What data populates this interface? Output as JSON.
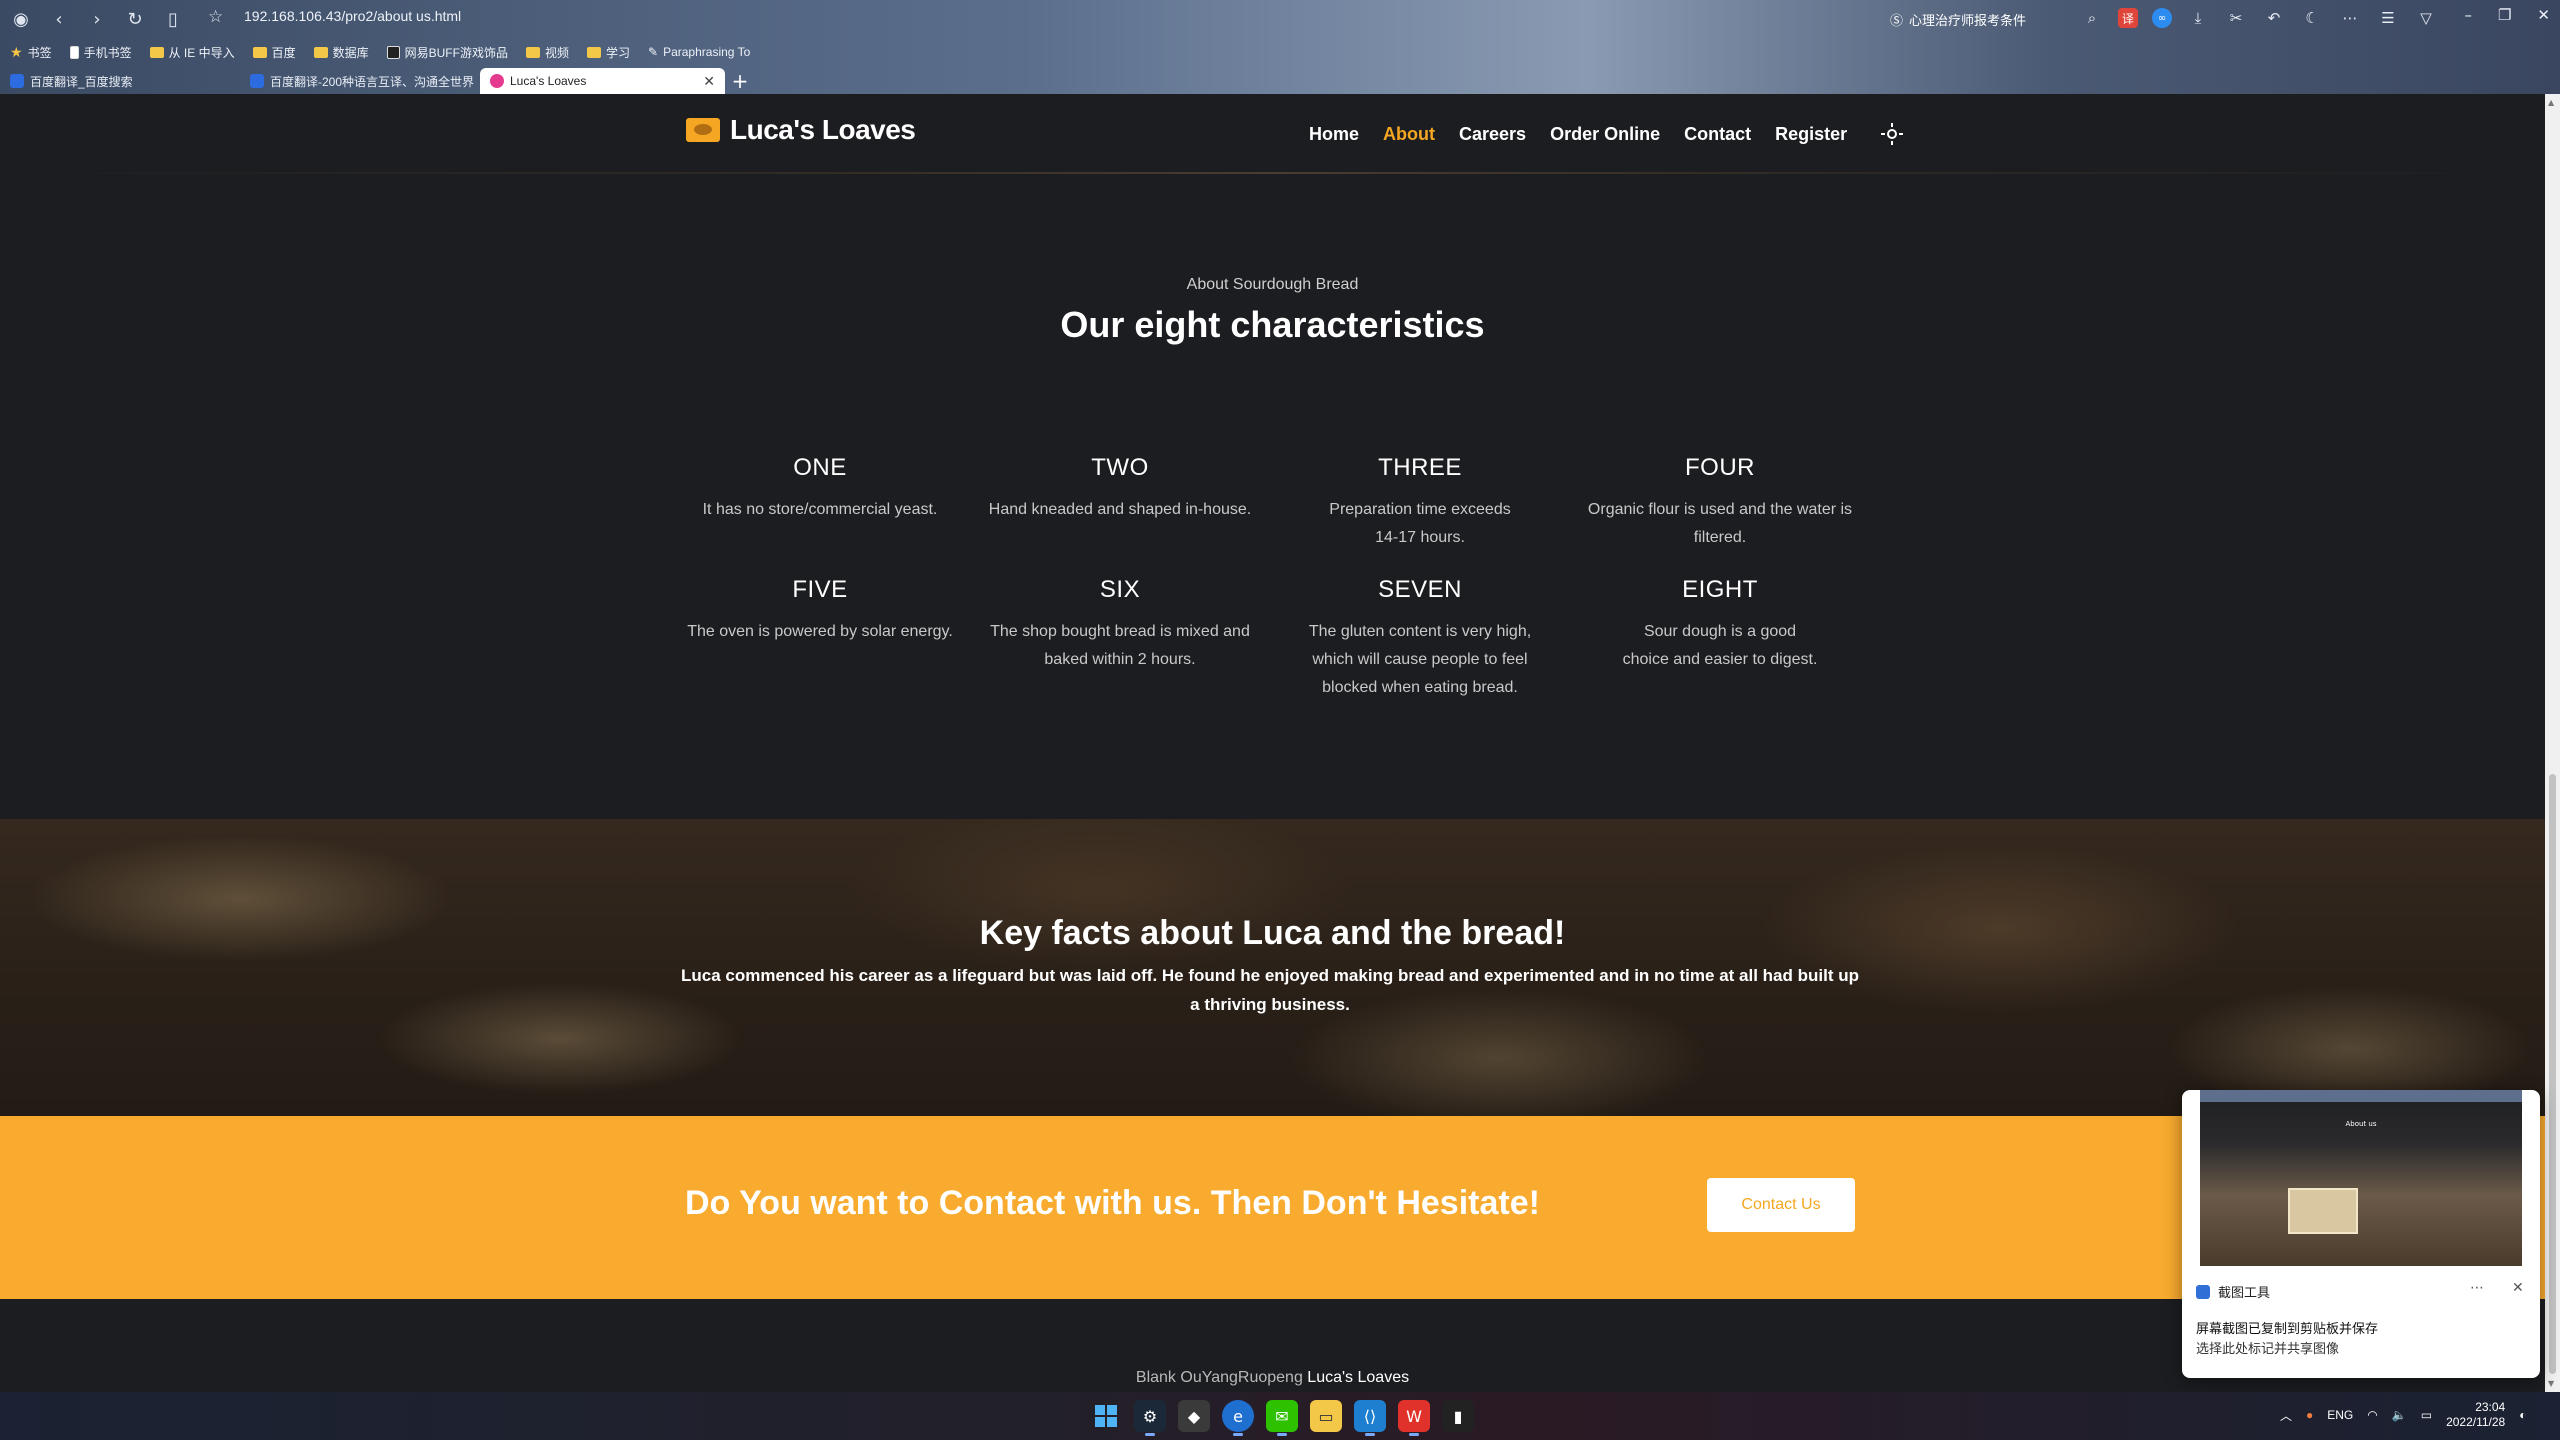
{
  "browser": {
    "url": "192.168.106.43/pro2/about us.html",
    "search_text": "心理治疗师报考条件",
    "bookmarks": [
      {
        "label": "书签",
        "icon": "star-icon"
      },
      {
        "label": "手机书签",
        "icon": "phone-icon"
      },
      {
        "label": "从 IE 中导入",
        "icon": "folder-icon"
      },
      {
        "label": "百度",
        "icon": "folder-icon"
      },
      {
        "label": "数据库",
        "icon": "folder-icon"
      },
      {
        "label": "网易BUFF游戏饰品",
        "icon": "app-icon"
      },
      {
        "label": "视频",
        "icon": "folder-icon"
      },
      {
        "label": "学习",
        "icon": "folder-icon"
      },
      {
        "label": "Paraphrasing To",
        "icon": "pen-icon"
      }
    ],
    "tabs": [
      {
        "label": "百度翻译_百度搜索",
        "active": false
      },
      {
        "label": "百度翻译-200种语言互译、沟通全世界",
        "active": false
      },
      {
        "label": "Luca's Loaves",
        "active": true
      }
    ]
  },
  "site": {
    "brand": "Luca's Loaves",
    "nav": [
      {
        "label": "Home",
        "active": false
      },
      {
        "label": "About",
        "active": true
      },
      {
        "label": "Careers",
        "active": false
      },
      {
        "label": "Order Online",
        "active": false
      },
      {
        "label": "Contact",
        "active": false
      },
      {
        "label": "Register",
        "active": false
      }
    ],
    "about": {
      "eyebrow": "About Sourdough Bread",
      "title": "Our eight characteristics",
      "items": [
        {
          "title": "ONE",
          "text": "It has no store/commercial yeast."
        },
        {
          "title": "TWO",
          "text": "Hand kneaded and shaped in-house."
        },
        {
          "title": "THREE",
          "text": "Preparation time exceeds 14-17 hours."
        },
        {
          "title": "FOUR",
          "text": "Organic flour is used and the water is filtered."
        },
        {
          "title": "FIVE",
          "text": "The oven is powered by solar energy."
        },
        {
          "title": "SIX",
          "text": "The shop bought bread is mixed and baked within 2 hours."
        },
        {
          "title": "SEVEN",
          "text": "The gluten content is very high, which will cause people to feel blocked when eating bread."
        },
        {
          "title": "EIGHT",
          "text": "Sour dough is a good choice and easier to digest."
        }
      ]
    },
    "facts": {
      "title": "Key facts about Luca and the bread!",
      "text": "Luca commenced his career as a lifeguard but was laid off. He found he enjoyed making bread and experimented and in no time at all had built up a thriving business."
    },
    "cta": {
      "text": "Do You want to Contact with us. Then Don't Hesitate!",
      "button": "Contact Us"
    },
    "footer": {
      "prefix": "Blank OuYangRuopeng",
      "brand": "Luca's Loaves"
    },
    "colors": {
      "accent": "#f5a623",
      "cta_bg": "#f8ab2e",
      "page_bg": "#1c1d21"
    }
  },
  "notification": {
    "thumb_title": "About us",
    "app": "截图工具",
    "line1": "屏幕截图已复制到剪贴板并保存",
    "line2": "选择此处标记并共享图像"
  },
  "taskbar": {
    "lang": "ENG",
    "time": "23:04",
    "date": "2022/11/28"
  }
}
